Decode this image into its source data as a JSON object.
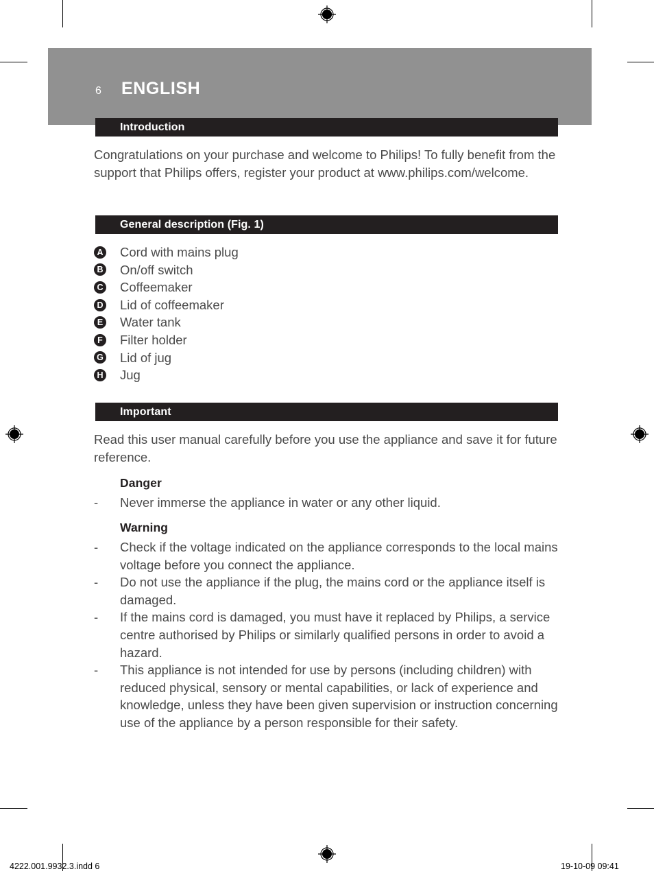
{
  "page": {
    "number": "6",
    "language_title": "ENGLISH",
    "background_color": "#ffffff",
    "masthead_color": "#919191",
    "bar_color": "#231f20",
    "body_text_color": "#4a4a4a"
  },
  "sections": {
    "introduction": {
      "heading": "Introduction",
      "paragraph": "Congratulations on your purchase and welcome to Philips! To fully benefit from the support that Philips offers, register your product at www.philips.com/welcome."
    },
    "general_description": {
      "heading": "General description (Fig. 1)",
      "parts": [
        {
          "letter": "A",
          "label": "Cord with mains plug"
        },
        {
          "letter": "B",
          "label": "On/off switch"
        },
        {
          "letter": "C",
          "label": "Coffeemaker"
        },
        {
          "letter": "D",
          "label": "Lid of coffeemaker"
        },
        {
          "letter": "E",
          "label": "Water tank"
        },
        {
          "letter": "F",
          "label": "Filter holder"
        },
        {
          "letter": "G",
          "label": "Lid of jug"
        },
        {
          "letter": "H",
          "label": "Jug"
        }
      ]
    },
    "important": {
      "heading": "Important",
      "intro": "Read this user manual carefully before you use the appliance and save it for future reference.",
      "danger": {
        "heading": "Danger",
        "bullet_marker": "-",
        "items": [
          "Never immerse the appliance in water or any other liquid."
        ]
      },
      "warning": {
        "heading": "Warning",
        "bullet_marker": "-",
        "items": [
          "Check if the voltage indicated on the appliance corresponds to the local mains voltage before you connect the appliance.",
          "Do not use the appliance if the plug, the mains cord or the appliance itself is damaged.",
          "If the mains cord is damaged, you must have it replaced by Philips, a service centre authorised by Philips or similarly qualified persons in order to avoid a hazard.",
          "This appliance is not intended for use by persons (including children) with reduced physical, sensory or mental capabilities, or lack of experience and knowledge, unless they have been given supervision or instruction concerning use of the appliance by a person responsible for their safety."
        ]
      }
    }
  },
  "footer": {
    "file_name": "4222.001.9932.3.indd   6",
    "timestamp": "19-10-09   09:41"
  }
}
